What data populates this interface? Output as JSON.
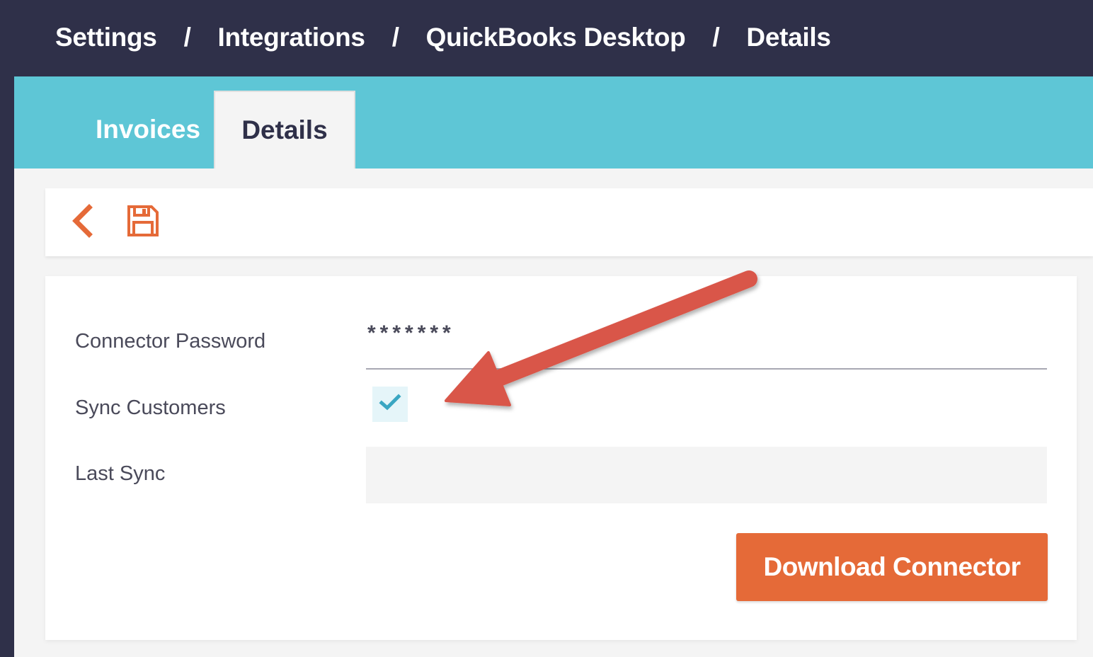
{
  "breadcrumb": {
    "items": [
      "Settings",
      "Integrations",
      "QuickBooks Desktop",
      "Details"
    ],
    "separator": "/"
  },
  "tabs": [
    {
      "label": "Invoices",
      "active": false
    },
    {
      "label": "Details",
      "active": true
    }
  ],
  "toolbar": {
    "back_icon": "chevron-left-icon",
    "save_icon": "floppy-disk-icon"
  },
  "form": {
    "connector_password": {
      "label": "Connector Password",
      "value": "*******"
    },
    "sync_customers": {
      "label": "Sync Customers",
      "checked": true
    },
    "last_sync": {
      "label": "Last Sync",
      "value": ""
    },
    "download_button": "Download Connector"
  },
  "colors": {
    "header_bg": "#2f3049",
    "tabbar_bg": "#5ec6d6",
    "accent_orange": "#e56a38",
    "check_color": "#3aa6c2",
    "annotation_arrow": "#d9574a"
  },
  "annotation": {
    "icon": "red-arrow-icon"
  }
}
